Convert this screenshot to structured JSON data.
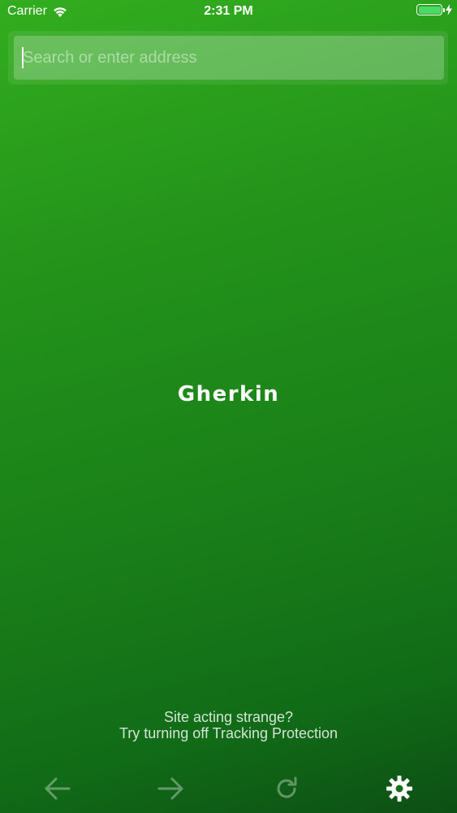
{
  "status_bar": {
    "carrier": "Carrier",
    "time": "2:31 PM",
    "battery_color": "#4cd964",
    "icons": [
      "wifi-icon",
      "battery-icon",
      "charging-bolt-icon"
    ]
  },
  "url_bar": {
    "placeholder": "Search or enter address",
    "value": ""
  },
  "home": {
    "logo_text": "Gherkin"
  },
  "tracking_hint": {
    "line1": "Site acting strange?",
    "line2": "Try turning off Tracking Protection"
  },
  "toolbar": {
    "buttons": [
      {
        "icon": "back-arrow-icon",
        "enabled": false
      },
      {
        "icon": "forward-arrow-icon",
        "enabled": false
      },
      {
        "icon": "reload-icon",
        "enabled": false
      },
      {
        "icon": "gear-icon",
        "enabled": true
      }
    ]
  },
  "theme": {
    "background_top": "#33ad1f",
    "background_bottom": "#0d4f15",
    "text_color": "#ffffff"
  }
}
